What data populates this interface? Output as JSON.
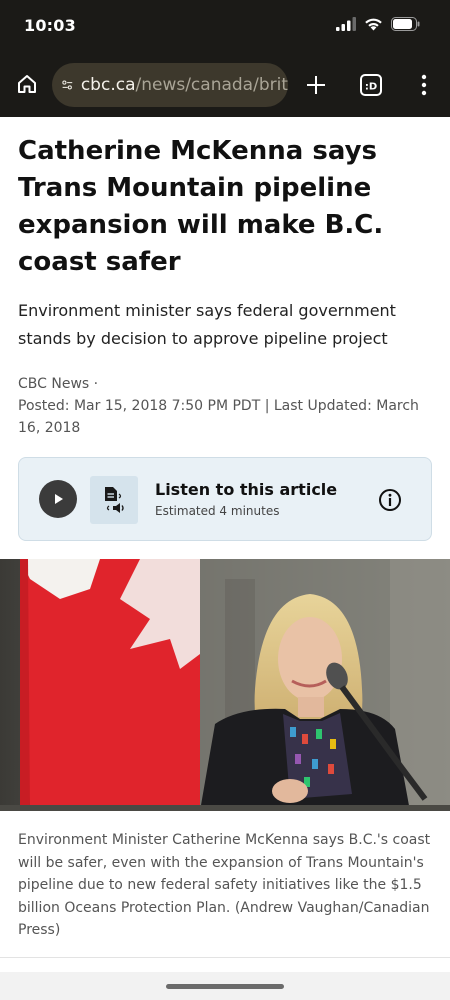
{
  "status_bar": {
    "time": "10:03"
  },
  "browser": {
    "url_domain": "cbc.ca",
    "url_path": "/news/canada/brit",
    "new_tab_icon": "plus-icon",
    "tabs_icon": "tab-switcher-icon",
    "tabs_count": ":D",
    "menu_icon": "more-vert-icon"
  },
  "article": {
    "headline": "Catherine McKenna says Trans Mountain pipeline expansion will make B.C. coast safer",
    "deck": "Environment minister says federal government stands by decision to approve pipeline project",
    "source": "CBC News ·",
    "dates": "Posted: Mar 15, 2018 7:50 PM PDT | Last Updated: March 16, 2018",
    "listen": {
      "title": "Listen to this article",
      "duration": "Estimated 4 minutes"
    },
    "caption": "Environment Minister Catherine McKenna says B.C.'s coast will be safer, even with the expansion of Trans Mountain's pipeline due to new federal safety initiatives like the $1.5 billion Oceans Protection Plan. (Andrew Vaughan/Canadian Press)"
  },
  "colors": {
    "chrome": "#1b1a17",
    "url_bar": "#3d382c",
    "listen_bg": "#e9f1f6",
    "flag_red": "#e0242c"
  }
}
